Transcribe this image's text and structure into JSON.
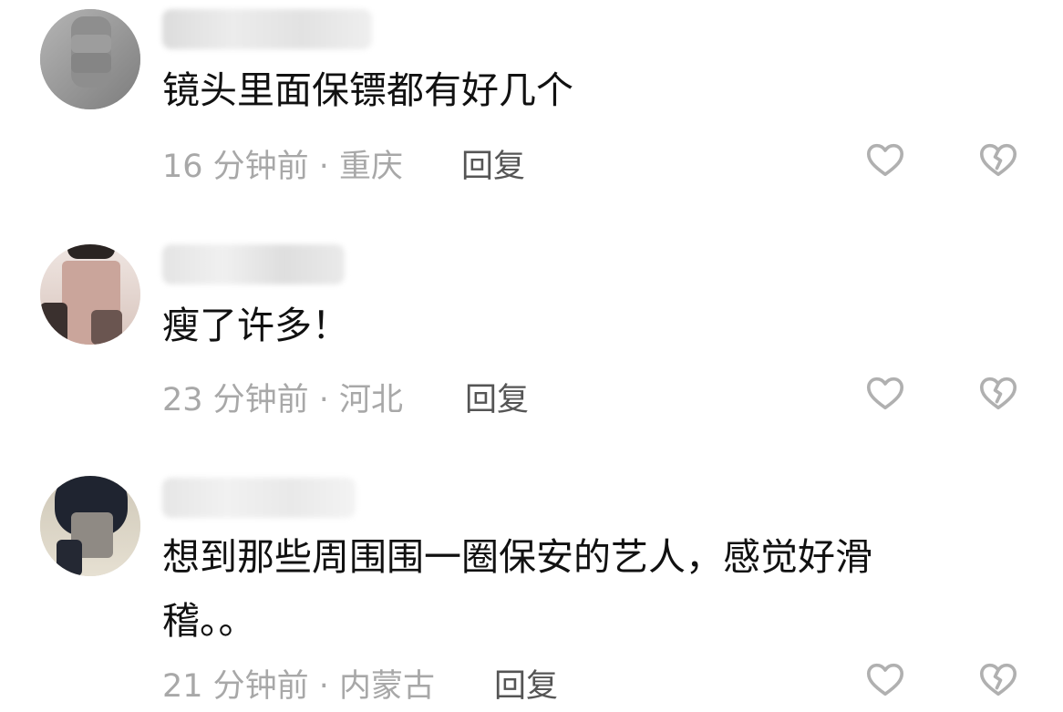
{
  "comments": [
    {
      "text": "镜头里面保镖都有好几个",
      "time": "16 分钟前 · 重庆",
      "reply_label": "回复",
      "username_visible_tail": "",
      "like_icon": "heart-outline-icon",
      "dislike_icon": "broken-heart-icon"
    },
    {
      "text": "瘦了许多！",
      "time": "23 分钟前 · 河北",
      "reply_label": "回复",
      "username_visible_tail": "",
      "like_icon": "heart-outline-icon",
      "dislike_icon": "broken-heart-icon"
    },
    {
      "text": "想到那些周围围一圈保安的艺人，感觉好滑稽。。",
      "time": "21 分钟前 · 内蒙古",
      "reply_label": "回复",
      "username_visible_tail": "",
      "like_icon": "heart-outline-icon",
      "dislike_icon": "broken-heart-icon"
    }
  ],
  "colors": {
    "text": "#111111",
    "meta": "#a8a8a8",
    "reply": "#555555",
    "icon": "#b0b0b0"
  }
}
